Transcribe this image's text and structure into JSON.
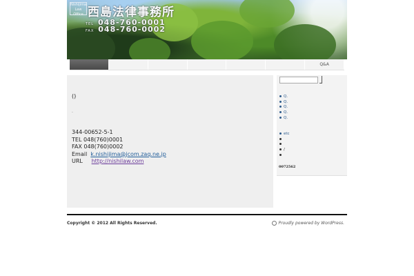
{
  "header": {
    "logo_text": "Nishijima Law Office",
    "site_title": "西島法律事務所",
    "tel_label": "TEL",
    "tel": "048-760-0001",
    "fax_label": "FAX",
    "fax": "048-760-0002"
  },
  "nav": {
    "items": [
      {
        "label": ""
      },
      {
        "label": ""
      },
      {
        "label": ""
      },
      {
        "label": ""
      },
      {
        "label": ""
      },
      {
        "label": ""
      },
      {
        "label": "Q&A"
      }
    ]
  },
  "content": {
    "parens": "()",
    "dot": ".",
    "address": "344-00652-5-1",
    "tel_line": "TEL 048(760)0001",
    "fax_line": "FAX 048(760)0002",
    "email_label": "Email",
    "email": "k.nishijima@jcom.zaq.ne.jp",
    "url_label": "URL",
    "url": "http://nishilaw.com"
  },
  "sidebar": {
    "qa_items": [
      {
        "label": "Q."
      },
      {
        "label": "Q."
      },
      {
        "label": "Q."
      },
      {
        "label": "Q."
      },
      {
        "label": "Q."
      }
    ],
    "misc_items": [
      {
        "label": "etc"
      },
      {
        "label": ""
      },
      {
        "label": ""
      },
      {
        "label": "/"
      },
      {
        "label": ""
      }
    ],
    "counter": "0072562"
  },
  "footer": {
    "copyright": "Copyright © 2012   All Rights Reserved.",
    "powered": "Proudly powered by WordPress."
  }
}
